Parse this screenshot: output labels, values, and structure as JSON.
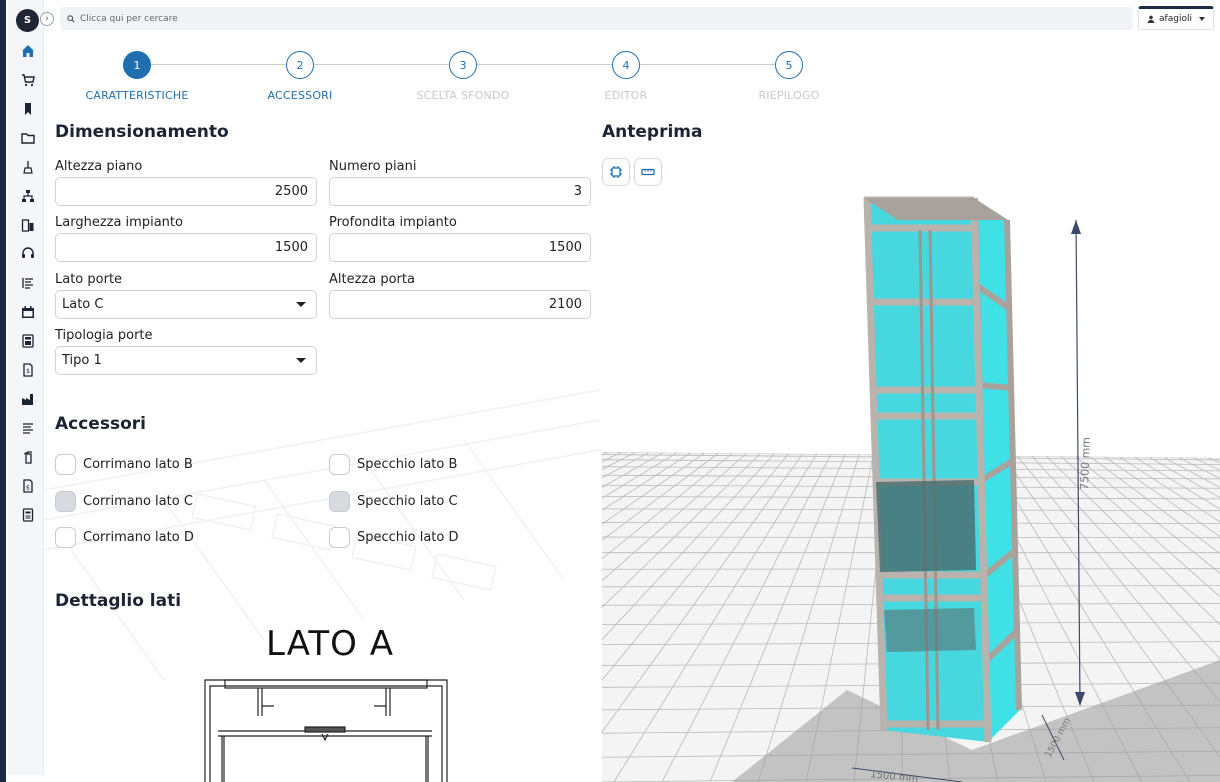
{
  "app": {
    "logo_text": "S"
  },
  "search": {
    "placeholder": "Clicca qui per cercare"
  },
  "user": {
    "name": "afagioli"
  },
  "stepper": {
    "steps": [
      {
        "number": "1",
        "label": "CARATTERISTICHE",
        "state": "active"
      },
      {
        "number": "2",
        "label": "ACCESSORI",
        "state": "enabled"
      },
      {
        "number": "3",
        "label": "SCELTA SFONDO",
        "state": "disabled"
      },
      {
        "number": "4",
        "label": "EDITOR",
        "state": "disabled"
      },
      {
        "number": "5",
        "label": "RIEPILOGO",
        "state": "disabled"
      }
    ]
  },
  "dimensioning": {
    "title": "Dimensionamento",
    "fields": {
      "altezza_piano": {
        "label": "Altezza piano",
        "value": "2500"
      },
      "numero_piani": {
        "label": "Numero piani",
        "value": "3"
      },
      "larghezza_impianto": {
        "label": "Larghezza impianto",
        "value": "1500"
      },
      "profondita_impianto": {
        "label": "Profondita impianto",
        "value": "1500"
      },
      "lato_porte": {
        "label": "Lato porte",
        "value": "Lato C"
      },
      "altezza_porta": {
        "label": "Altezza porta",
        "value": "2100"
      },
      "tipologia_porte": {
        "label": "Tipologia porte",
        "value": "Tipo 1"
      }
    }
  },
  "accessories": {
    "title": "Accessori",
    "items": [
      {
        "label": "Corrimano lato B",
        "checked": false
      },
      {
        "label": "Specchio lato B",
        "checked": false
      },
      {
        "label": "Corrimano lato C",
        "checked": false
      },
      {
        "label": "Specchio lato C",
        "checked": false
      },
      {
        "label": "Corrimano lato D",
        "checked": false
      },
      {
        "label": "Specchio lato D",
        "checked": false
      }
    ]
  },
  "detail": {
    "title": "Dettaglio lati",
    "drawing_title": "LATO A"
  },
  "preview": {
    "title": "Anteprima",
    "tools": [
      "chip-icon",
      "ruler-icon"
    ],
    "dimensions": {
      "height": "7500 mm",
      "depth": "1500 mm",
      "width": "1500 mm"
    },
    "glass_color": "#3fe0e6",
    "frame_color": "#b9b2ad"
  },
  "colors": {
    "accent": "#1f6fb0",
    "sidebar_dark": "#1c2a44"
  },
  "nav_icons": [
    "home-icon",
    "cart-icon",
    "bookmark-icon",
    "folder-icon",
    "broom-icon",
    "org-chart-icon",
    "buildings-icon",
    "headset-icon",
    "list-icon",
    "calendar-icon",
    "calculator-icon",
    "invoice-icon",
    "factory-icon",
    "lines-icon",
    "extinguisher-icon",
    "invoice-dollar-icon",
    "document-icon"
  ]
}
